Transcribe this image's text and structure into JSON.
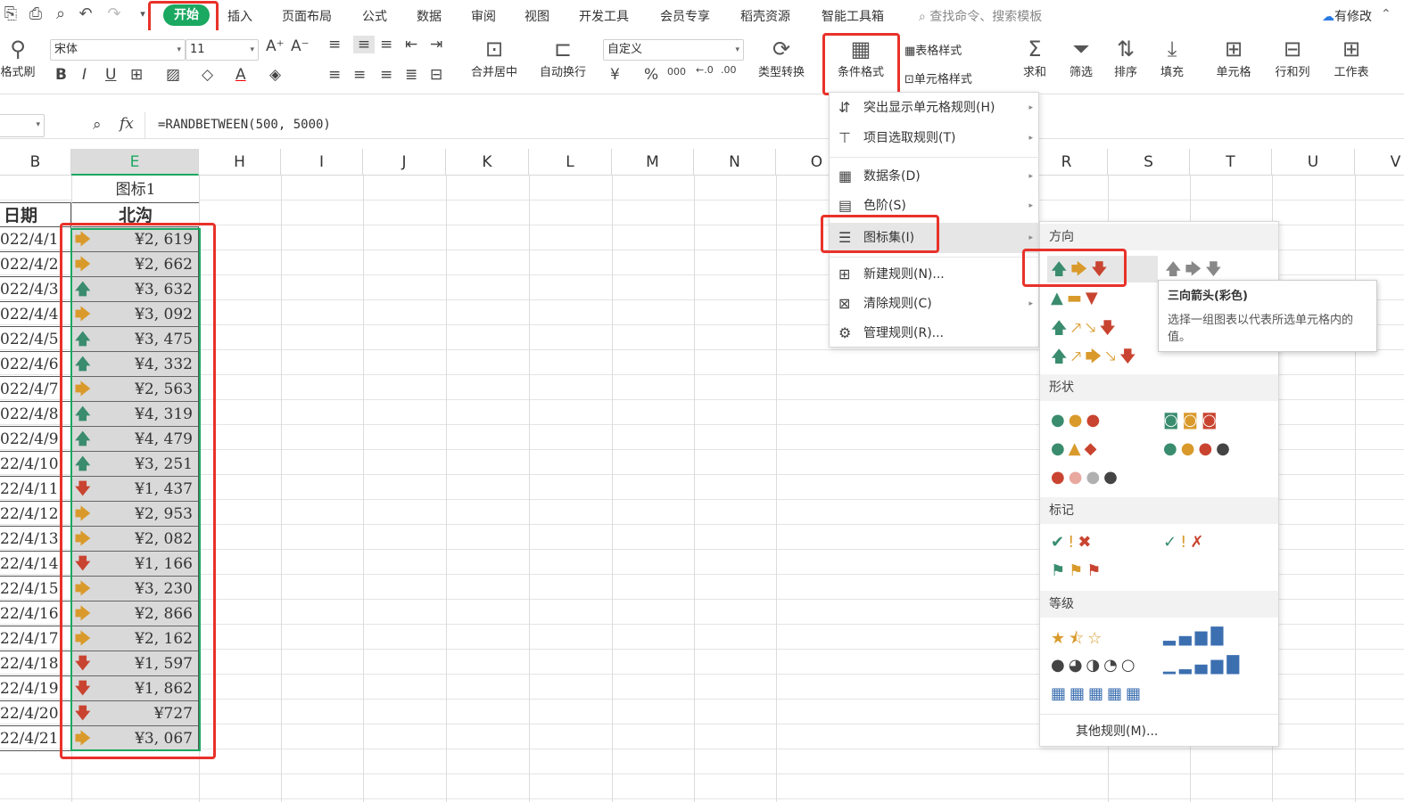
{
  "menu": {
    "items": [
      "插入",
      "页面布局",
      "公式",
      "数据",
      "审阅",
      "视图",
      "开发工具",
      "会员专享",
      "稻壳资源",
      "智能工具箱"
    ],
    "start": "开始",
    "search_placeholder": "查找命令、搜索模板",
    "has_changes": "有修改"
  },
  "ribbon": {
    "format_painter": "格式刷",
    "font_name": "宋体",
    "font_size": "11",
    "merge_center": "合并居中",
    "wrap_text": "自动换行",
    "number_format": "自定义",
    "type_convert": "类型转换",
    "cond_format": "条件格式",
    "table_style": "表格样式",
    "cell_style": "单元格样式",
    "sum": "求和",
    "filter": "筛选",
    "sort": "排序",
    "fill": "填充",
    "cell": "单元格",
    "row_col": "行和列",
    "worksheet": "工作表",
    "bold": "B",
    "italic": "I",
    "underline": "U",
    "font_color_letter": "A",
    "currency_symbol": "¥",
    "percent": "%",
    "thousands": "000"
  },
  "formula_bar": {
    "fx": "fx",
    "formula": "=RANDBETWEEN(500, 5000)"
  },
  "columns": [
    "B",
    "E",
    "H",
    "I",
    "J",
    "K",
    "L",
    "M",
    "N",
    "O",
    "R",
    "S",
    "T",
    "U",
    "V"
  ],
  "sheet": {
    "chart_label": "图标1",
    "header_date": "日期",
    "header_value": "北沟",
    "rows": [
      {
        "date": "022/4/1",
        "value": "¥2, 619",
        "icon": "right"
      },
      {
        "date": "022/4/2",
        "value": "¥2, 662",
        "icon": "right"
      },
      {
        "date": "022/4/3",
        "value": "¥3, 632",
        "icon": "up"
      },
      {
        "date": "022/4/4",
        "value": "¥3, 092",
        "icon": "right"
      },
      {
        "date": "022/4/5",
        "value": "¥3, 475",
        "icon": "up"
      },
      {
        "date": "022/4/6",
        "value": "¥4, 332",
        "icon": "up"
      },
      {
        "date": "022/4/7",
        "value": "¥2, 563",
        "icon": "right"
      },
      {
        "date": "022/4/8",
        "value": "¥4, 319",
        "icon": "up"
      },
      {
        "date": "022/4/9",
        "value": "¥4, 479",
        "icon": "up"
      },
      {
        "date": "22/4/10",
        "value": "¥3, 251",
        "icon": "up"
      },
      {
        "date": "22/4/11",
        "value": "¥1, 437",
        "icon": "down"
      },
      {
        "date": "22/4/12",
        "value": "¥2, 953",
        "icon": "right"
      },
      {
        "date": "22/4/13",
        "value": "¥2, 082",
        "icon": "right"
      },
      {
        "date": "22/4/14",
        "value": "¥1, 166",
        "icon": "down"
      },
      {
        "date": "22/4/15",
        "value": "¥3, 230",
        "icon": "right"
      },
      {
        "date": "22/4/16",
        "value": "¥2, 866",
        "icon": "right"
      },
      {
        "date": "22/4/17",
        "value": "¥2, 162",
        "icon": "right"
      },
      {
        "date": "22/4/18",
        "value": "¥1, 597",
        "icon": "down"
      },
      {
        "date": "22/4/19",
        "value": "¥1, 862",
        "icon": "down"
      },
      {
        "date": "22/4/20",
        "value": "¥727",
        "icon": "down"
      },
      {
        "date": "22/4/21",
        "value": "¥3, 067",
        "icon": "right"
      }
    ]
  },
  "cond_menu": {
    "items": [
      "突出显示单元格规则(H)",
      "项目选取规则(T)",
      "数据条(D)",
      "色阶(S)",
      "图标集(I)",
      "新建规则(N)...",
      "清除规则(C)",
      "管理规则(R)..."
    ]
  },
  "iconset_menu": {
    "sections": [
      "方向",
      "形状",
      "标记",
      "等级"
    ],
    "other_rules": "其他规则(M)..."
  },
  "tooltip": {
    "title": "三向箭头(彩色)",
    "body": "选择一组图表以代表所选单元格内的值。"
  }
}
